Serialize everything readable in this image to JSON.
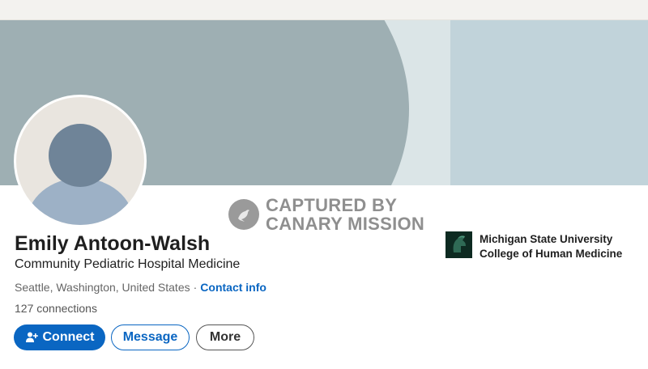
{
  "profile": {
    "name": "Emily Antoon-Walsh",
    "headline": "Community Pediatric Hospital Medicine",
    "location": "Seattle, Washington, United States",
    "separator": "·",
    "contact_info_label": "Contact info",
    "connections": "127 connections"
  },
  "actions": {
    "connect_label": "Connect",
    "message_label": "Message",
    "more_label": "More"
  },
  "education": {
    "line1": "Michigan State University",
    "line2": "College of Human Medicine"
  },
  "watermark": {
    "line1": "CAPTURED BY",
    "line2": "CANARY MISSION"
  },
  "icons": {
    "connect": "add-person-icon",
    "avatar": "default-avatar-icon",
    "school_logo": "spartan-helmet-icon",
    "watermark": "canary-bird-icon"
  },
  "colors": {
    "primary": "#0a66c2",
    "banner": "#9eafb3",
    "banner_light": "#c1d3da"
  }
}
